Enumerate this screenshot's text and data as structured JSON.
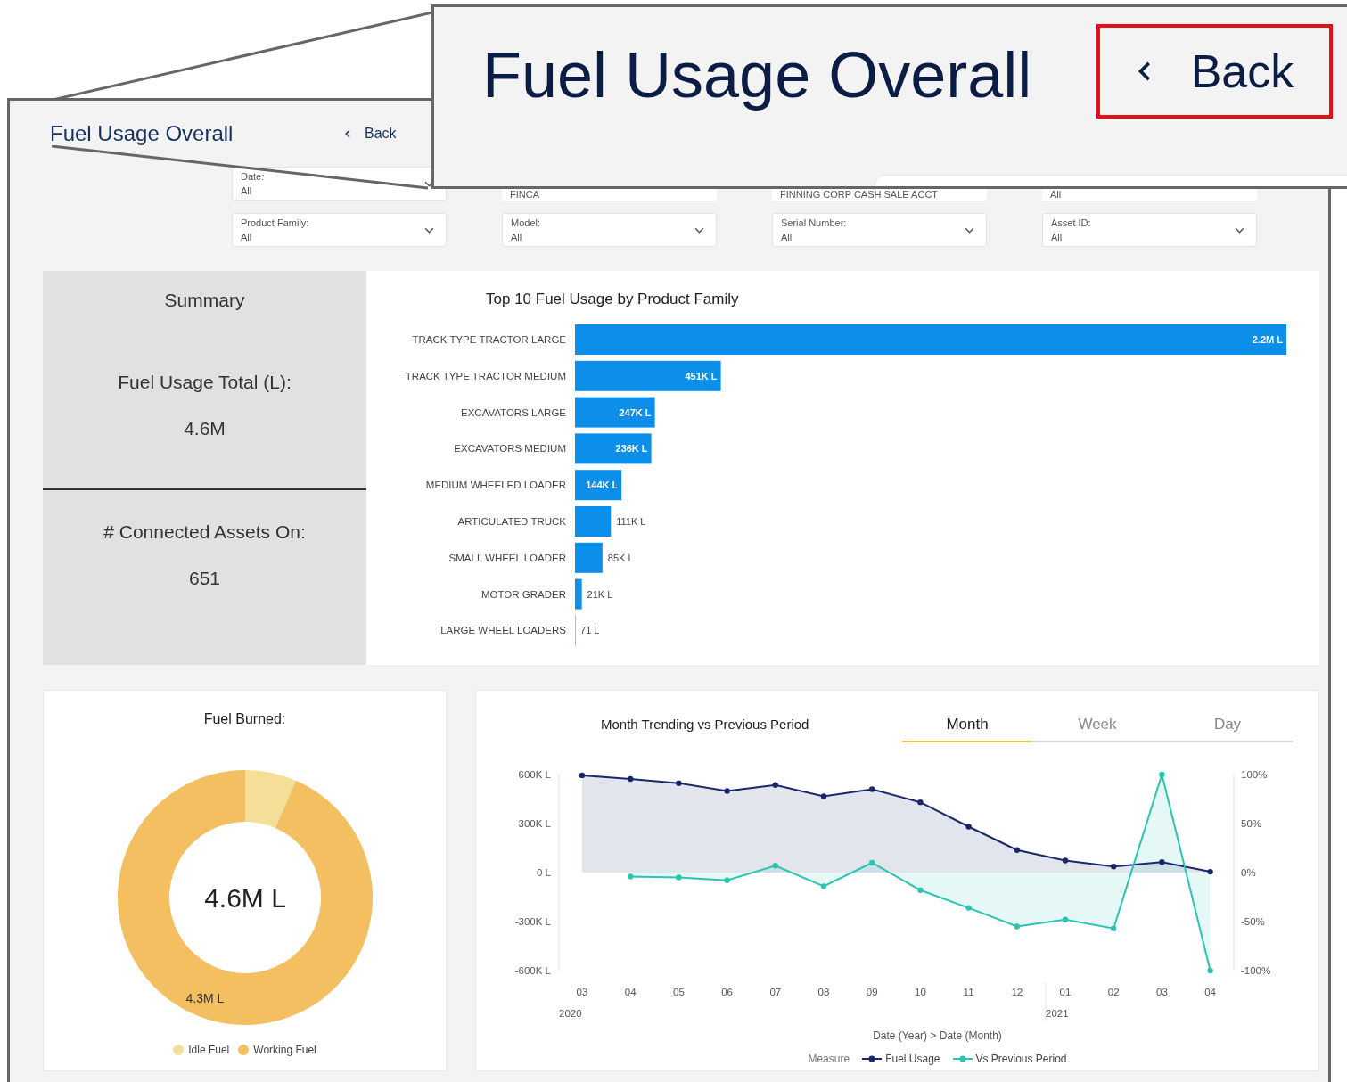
{
  "page": {
    "title": "Fuel Usage Overall",
    "back_label": "Back"
  },
  "callout": {
    "title": "Fuel Usage Overall",
    "back_label": "Back",
    "highlighted": true
  },
  "filters": [
    {
      "label": "Date:",
      "value": "All"
    },
    {
      "value": "FINCA"
    },
    {
      "value": "FINNING CORP CASH SALE ACCT"
    },
    {
      "value": "All"
    },
    {
      "label": "Product Family:",
      "value": "All"
    },
    {
      "label": "Model:",
      "value": "All"
    },
    {
      "label": "Serial Number:",
      "value": "All"
    },
    {
      "label": "Asset ID:",
      "value": "All"
    }
  ],
  "summary": {
    "title": "Summary",
    "metrics": [
      {
        "label": "Fuel Usage Total (L):",
        "value": "4.6M"
      },
      {
        "label": "# Connected Assets On:",
        "value": "651"
      }
    ]
  },
  "bar_panel": {
    "chart_data": {
      "type": "bar",
      "orientation": "horizontal",
      "title": "Top 10 Fuel Usage by Product Family",
      "categories": [
        "TRACK TYPE TRACTOR LARGE",
        "TRACK TYPE TRACTOR MEDIUM",
        "EXCAVATORS LARGE",
        "EXCAVATORS MEDIUM",
        "MEDIUM WHEELED LOADER",
        "ARTICULATED TRUCK",
        "SMALL WHEEL LOADER",
        "MOTOR GRADER",
        "LARGE WHEEL LOADERS"
      ],
      "values": [
        2200000,
        451000,
        247000,
        236000,
        144000,
        111000,
        85000,
        21000,
        71
      ],
      "value_labels": [
        "2.2M L",
        "451K L",
        "247K L",
        "236K L",
        "144K L",
        "111K L",
        "85K L",
        "21K L",
        "71 L"
      ]
    }
  },
  "fuel_burned": {
    "chart_data": {
      "type": "donut",
      "title": "Fuel Burned:",
      "categories": [
        "Idle Fuel",
        "Working Fuel"
      ],
      "values": [
        300000,
        4300000
      ],
      "value_labels": [
        null,
        "4.3M L"
      ]
    },
    "center_label": "4.6M L",
    "legend": [
      {
        "color": "#f5de97"
      },
      {
        "color": "#f3bf60"
      }
    ]
  },
  "trend": {
    "tabs": [
      {
        "label": "Month",
        "selected": true
      },
      {
        "label": "Week",
        "selected": false
      },
      {
        "label": "Day",
        "selected": false
      }
    ],
    "chart_data": {
      "type": "area",
      "title": "Month Trending vs Previous Period",
      "xlabel": "Date (Year) > Date (Month)",
      "categories": [
        "03",
        "04",
        "05",
        "06",
        "07",
        "08",
        "09",
        "10",
        "11",
        "12",
        "01",
        "02",
        "03",
        "04"
      ],
      "annotations": [
        "2020",
        "2021"
      ],
      "ylim": [
        -600000,
        600000
      ],
      "y2lim": [
        -100,
        100
      ],
      "yticks": [
        {
          "value": 600000,
          "label": "600K L"
        },
        {
          "value": 300000,
          "label": "300K L"
        },
        {
          "value": 0,
          "label": "0 L"
        },
        {
          "value": -300000,
          "label": "-300K L"
        },
        {
          "value": -600000,
          "label": "-600K L"
        }
      ],
      "y2ticks": [
        {
          "value": 100,
          "label": "100%"
        },
        {
          "value": 50,
          "label": "50%"
        },
        {
          "value": 0,
          "label": "0%"
        },
        {
          "value": -50,
          "label": "-50%"
        },
        {
          "value": -100,
          "label": "-100%"
        }
      ],
      "series": [
        {
          "name": "Fuel Usage",
          "color": "#18286b",
          "values": [
            595000,
            573000,
            547000,
            499000,
            536000,
            467000,
            510000,
            430000,
            281000,
            138000,
            74000,
            37000,
            64000,
            5000
          ]
        },
        {
          "name": "Vs Previous Period",
          "color": "#2cc3b3",
          "axis": "y2",
          "values": [
            null,
            -4,
            -5,
            -8,
            7,
            -14,
            10,
            -18,
            -36,
            -55,
            -48,
            -57,
            100,
            -100
          ]
        }
      ]
    },
    "legend_title": "Measure"
  }
}
